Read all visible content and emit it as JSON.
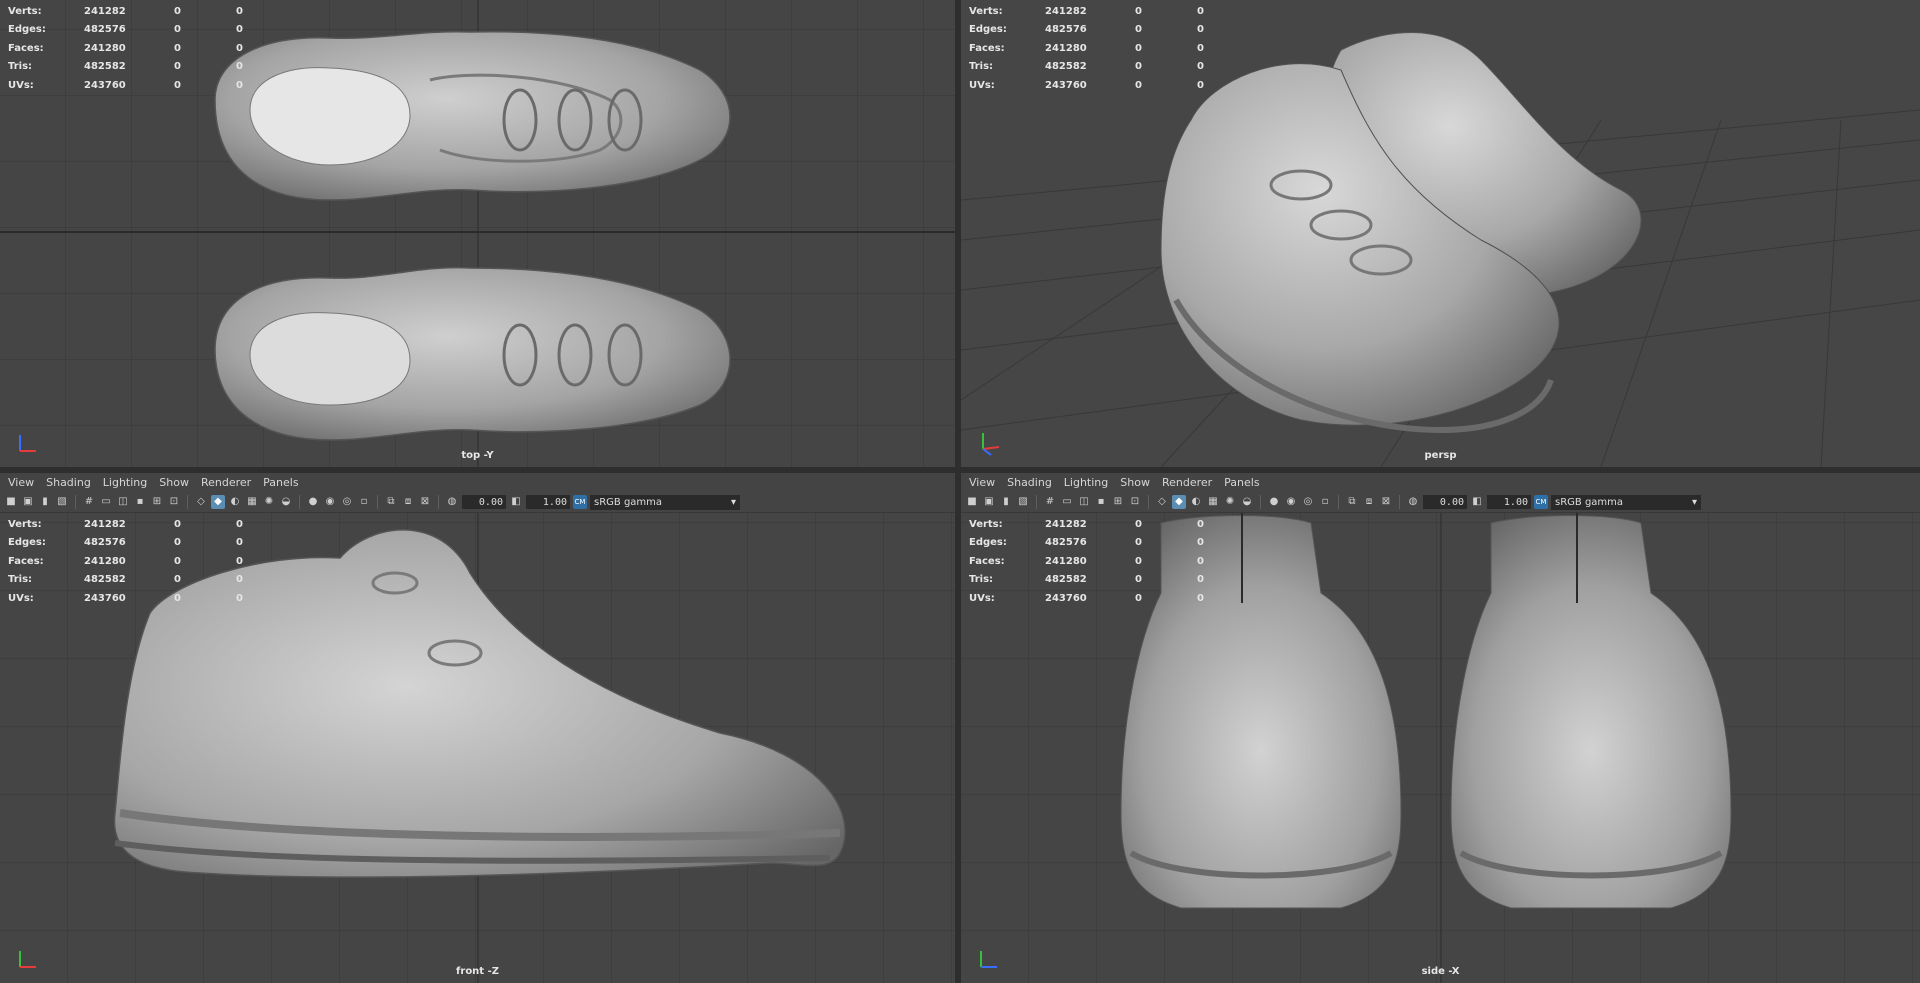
{
  "menus": [
    "View",
    "Shading",
    "Lighting",
    "Show",
    "Renderer",
    "Panels"
  ],
  "toolbar": {
    "exposure": "0.00",
    "gamma": "1.00",
    "colorspace": "sRGB gamma",
    "cs_badge": "CM"
  },
  "hud": {
    "rows": [
      {
        "label": "Verts:",
        "total": "241282",
        "selected": "0",
        "uv": "0"
      },
      {
        "label": "Edges:",
        "total": "482576",
        "selected": "0",
        "uv": "0"
      },
      {
        "label": "Faces:",
        "total": "241280",
        "selected": "0",
        "uv": "0"
      },
      {
        "label": "Tris:",
        "total": "482582",
        "selected": "0",
        "uv": "0"
      },
      {
        "label": "UVs:",
        "total": "243760",
        "selected": "0",
        "uv": "0"
      }
    ]
  },
  "panes": {
    "top": {
      "camera": "top -Y"
    },
    "persp": {
      "camera": "persp"
    },
    "front": {
      "camera": "front -Z"
    },
    "side": {
      "camera": "side -X"
    }
  },
  "colors": {
    "viewport_bg": "#444444",
    "grid": "#333333",
    "grid_major": "#2a2a2a",
    "mesh": "#9a9a9a",
    "mesh_light": "#c8c8c8",
    "mesh_dark": "#5c5c5c",
    "accent": "#5c8db3"
  }
}
